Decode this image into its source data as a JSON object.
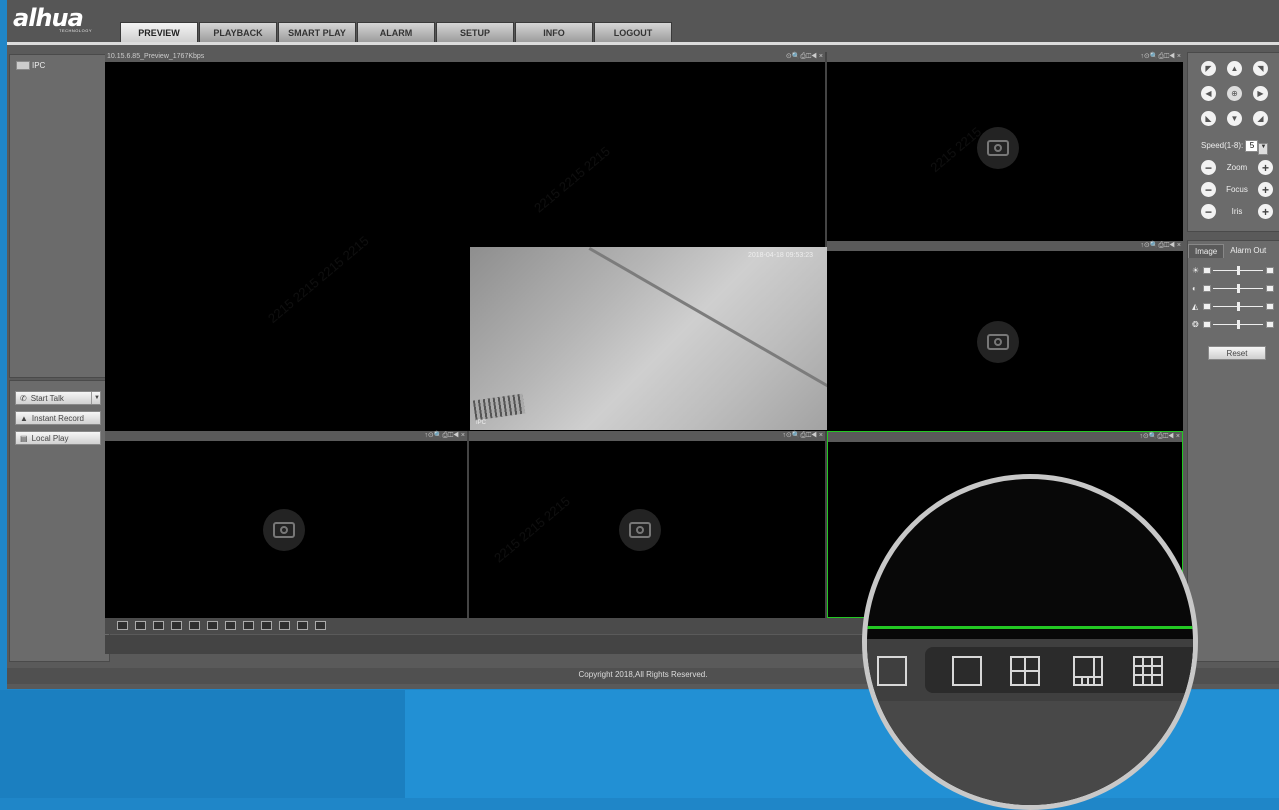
{
  "brand": {
    "logo": "alhua",
    "logo_sub": "TECHNOLOGY"
  },
  "tabs": [
    {
      "label": "PREVIEW"
    },
    {
      "label": "PLAYBACK"
    },
    {
      "label": "SMART PLAY"
    },
    {
      "label": "ALARM"
    },
    {
      "label": "SETUP"
    },
    {
      "label": "INFO"
    },
    {
      "label": "LOGOUT"
    }
  ],
  "device_tree": {
    "item": "IPC"
  },
  "left_actions": {
    "start_talk": "Start Talk",
    "instant_record": "Instant Record",
    "local_play": "Local Play"
  },
  "main_pane": {
    "title": "10.15.6.85_Preview_1767Kbps",
    "icons": "⊙🔍⎙◫◀ ×"
  },
  "pane_icons": "↑⊙🔍⎙◫◀ ×",
  "live_view": {
    "timestamp": "2018-04-18 09:53:23",
    "label": "IPC"
  },
  "ptz": {
    "speed_label": "Speed(1-8):",
    "speed_value": "5",
    "zoom": "Zoom",
    "focus": "Focus",
    "iris": "Iris"
  },
  "image_panel": {
    "tab_image": "Image",
    "tab_alarm": "Alarm Out",
    "reset": "Reset"
  },
  "footer": {
    "copyright": "Copyright 2018,All Rights Reserved."
  },
  "colors": {
    "selected_pane_border": "#23c823",
    "background": "#1f86c8"
  }
}
